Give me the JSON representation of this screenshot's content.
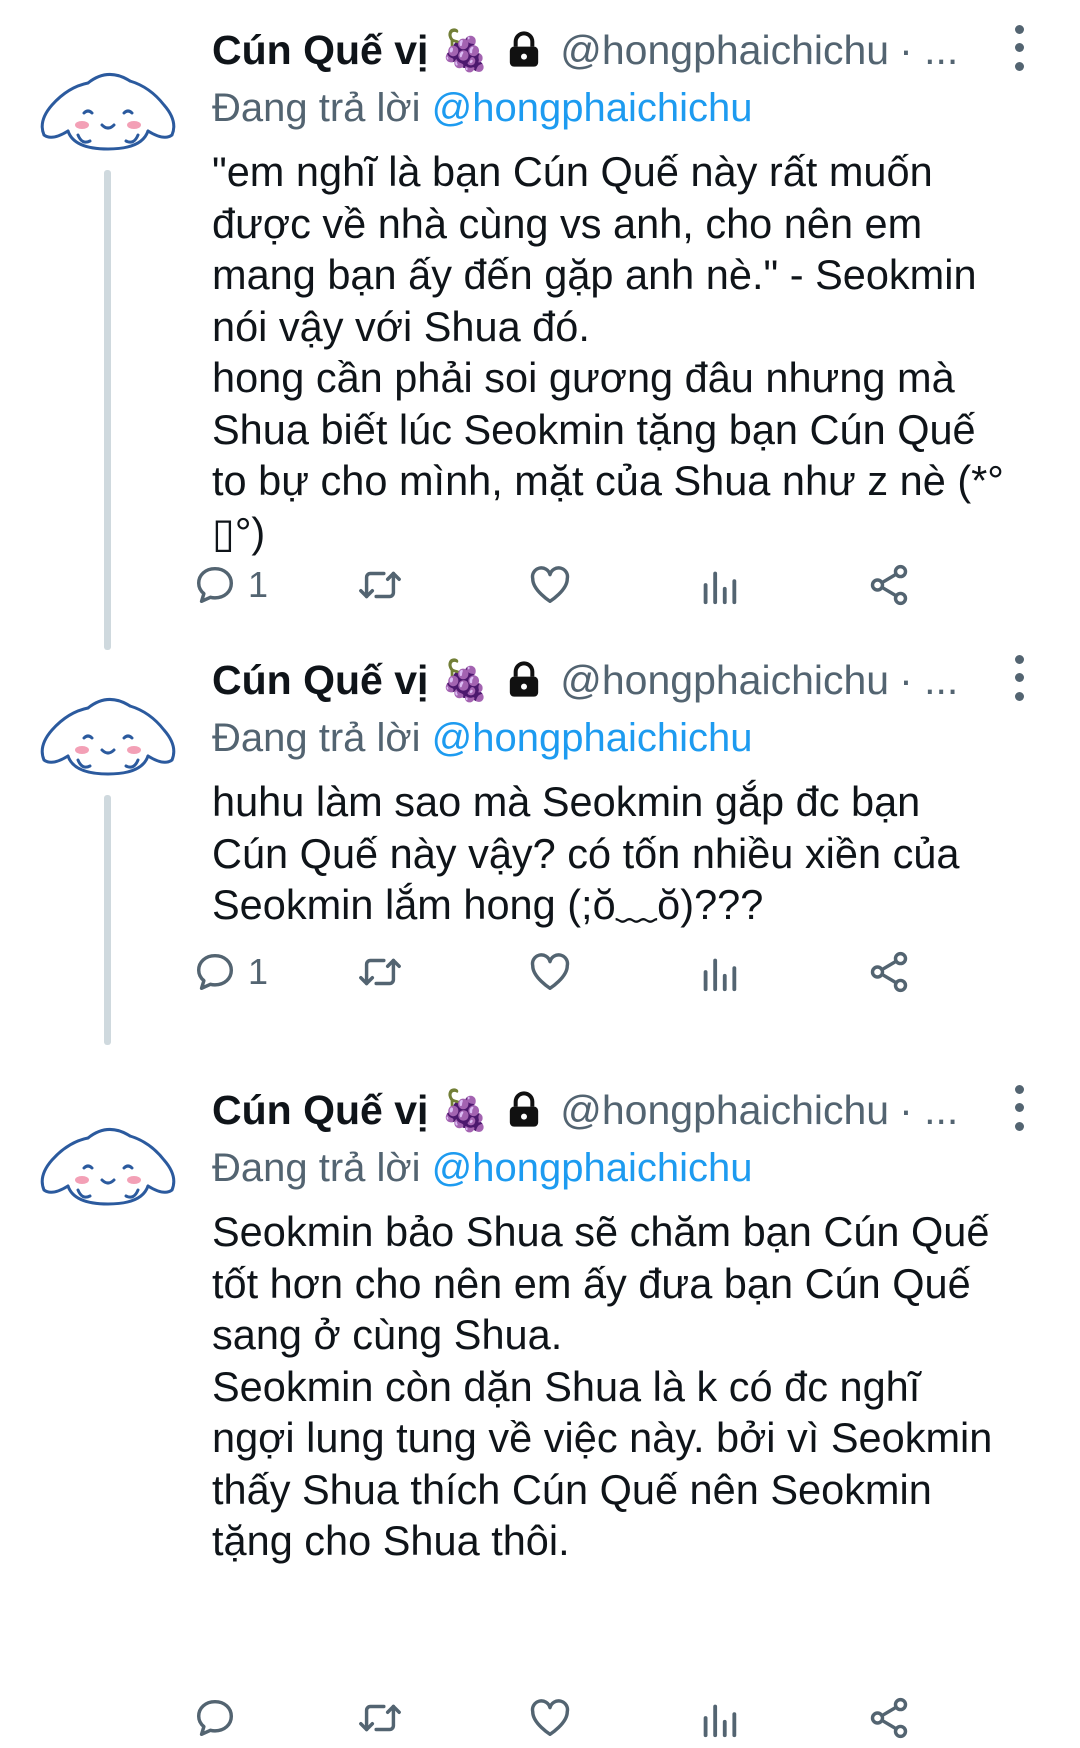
{
  "tweets": [
    {
      "name": "Cún Quế vị",
      "emoji": "🍇",
      "handle": "@hongphaichichu",
      "dot": "· ...",
      "reply_prefix": "Đang trả lời ",
      "reply_to": "@hongphaichichu",
      "text": "\"em nghĩ là bạn Cún Quế này rất muốn\nđược về nhà cùng vs anh, cho nên em\nmang bạn ấy đến gặp anh nè.\" - Seokmin\nnói vậy với Shua đó.\nhong cần phải soi gương đâu nhưng mà\nShua biết lúc Seokmin tặng bạn Cún Quế\nto bự cho mình, mặt của Shua như z nè (*°\n▯°)",
      "reply_count": "1"
    },
    {
      "name": "Cún Quế vị",
      "emoji": "🍇",
      "handle": "@hongphaichichu",
      "dot": "· ...",
      "reply_prefix": "Đang trả lời ",
      "reply_to": "@hongphaichichu",
      "text": "huhu làm sao mà Seokmin gắp đc bạn\nCún Quế này vậy? có tốn nhiều xiền của\nSeokmin lắm hong (;ŏ﹏ŏ)???",
      "reply_count": "1"
    },
    {
      "name": "Cún Quế vị",
      "emoji": "🍇",
      "handle": "@hongphaichichu",
      "dot": "· ...",
      "reply_prefix": "Đang trả lời ",
      "reply_to": "@hongphaichichu",
      "text": "Seokmin bảo Shua sẽ chăm bạn Cún Quế\ntốt hơn cho nên em ấy đưa bạn Cún Quế\nsang ở cùng Shua.\nSeokmin còn dặn Shua là k có đc nghĩ\nngợi lung tung về việc này. bởi vì Seokmin\nthấy Shua thích Cún Quế nên Seokmin\ntặng cho Shua thôi.",
      "reply_count": ""
    }
  ],
  "colors": {
    "link": "#1d9bf0",
    "muted": "#536471",
    "thread_line": "#cfd9de",
    "avatar_stroke": "#2b5a9e",
    "avatar_blush": "#f3a0b6"
  },
  "icons": [
    "avatar-cinnamoroll",
    "lock-icon",
    "more-icon",
    "reply-icon",
    "retweet-icon",
    "like-icon",
    "analytics-icon",
    "share-icon"
  ]
}
